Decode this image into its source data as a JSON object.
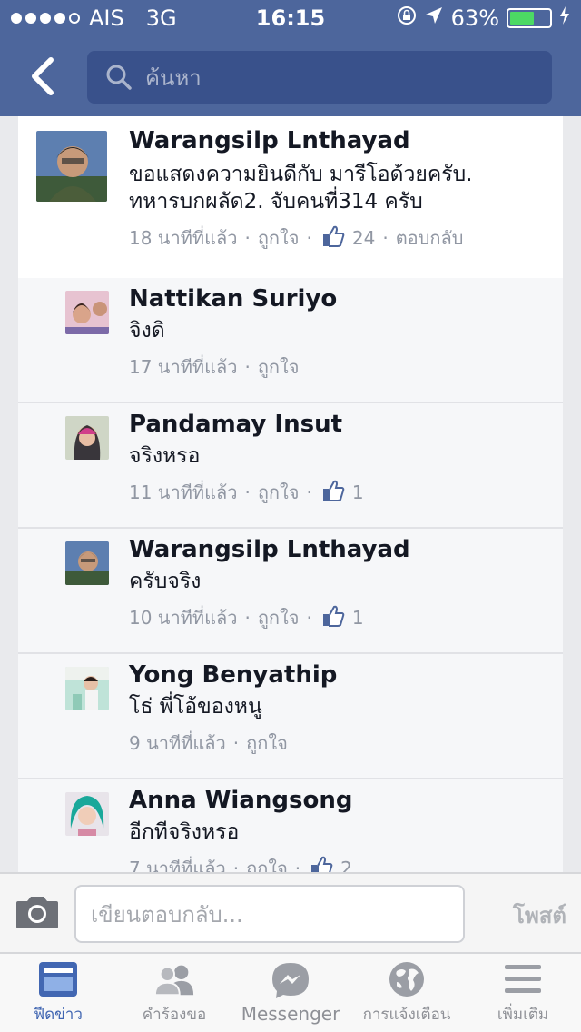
{
  "status_bar": {
    "carrier": "AIS",
    "network": "3G",
    "time": "16:15",
    "battery_percent": "63%",
    "battery_level": 0.63
  },
  "nav": {
    "search_placeholder": "ค้นหา"
  },
  "main_comment": {
    "author": "Warangsilp Lnthayad",
    "text_line1": "ขอแสดงความยินดีกับ มารีโอด้วยครับ.",
    "text_line2": "ทหารบกผลัด2. จับคนที่314 ครับ",
    "time": "18 นาทีที่แล้ว",
    "like_label": "ถูกใจ",
    "like_count": "24",
    "reply_label": "ตอบกลับ"
  },
  "replies": [
    {
      "author": "Nattikan Suriyo",
      "text": "จิงดิ",
      "time": "17 นาทีที่แล้ว",
      "like_label": "ถูกใจ",
      "like_count": ""
    },
    {
      "author": "Pandamay Insut",
      "text": "จริงหรอ",
      "time": "11 นาทีที่แล้ว",
      "like_label": "ถูกใจ",
      "like_count": "1"
    },
    {
      "author": "Warangsilp Lnthayad",
      "text": "ครับจริง",
      "time": "10 นาทีที่แล้ว",
      "like_label": "ถูกใจ",
      "like_count": "1"
    },
    {
      "author": "Yong Benyathip",
      "text": "โธ่ พี่โอ้ของหนู",
      "time": "9 นาทีที่แล้ว",
      "like_label": "ถูกใจ",
      "like_count": ""
    },
    {
      "author": "Anna Wiangsong",
      "text": "อีกทีจริงหรอ",
      "time": "7 นาทีที่แล้ว",
      "like_label": "ถูกใจ",
      "like_count": "2"
    }
  ],
  "composer": {
    "placeholder": "เขียนตอบกลับ...",
    "post_label": "โพสต์"
  },
  "tabs": [
    {
      "label": "ฟีดข่าว",
      "icon": "news-feed-icon",
      "active": true
    },
    {
      "label": "คำร้องขอ",
      "icon": "friend-requests-icon",
      "active": false
    },
    {
      "label": "Messenger",
      "icon": "messenger-icon",
      "active": false
    },
    {
      "label": "การแจ้งเตือน",
      "icon": "globe-icon",
      "active": false
    },
    {
      "label": "เพิ่มเติม",
      "icon": "menu-icon",
      "active": false
    }
  ],
  "colors": {
    "header": "#4d669c",
    "search_bg": "#39518b",
    "active_tab": "#4267b2",
    "battery": "#4cd964"
  }
}
